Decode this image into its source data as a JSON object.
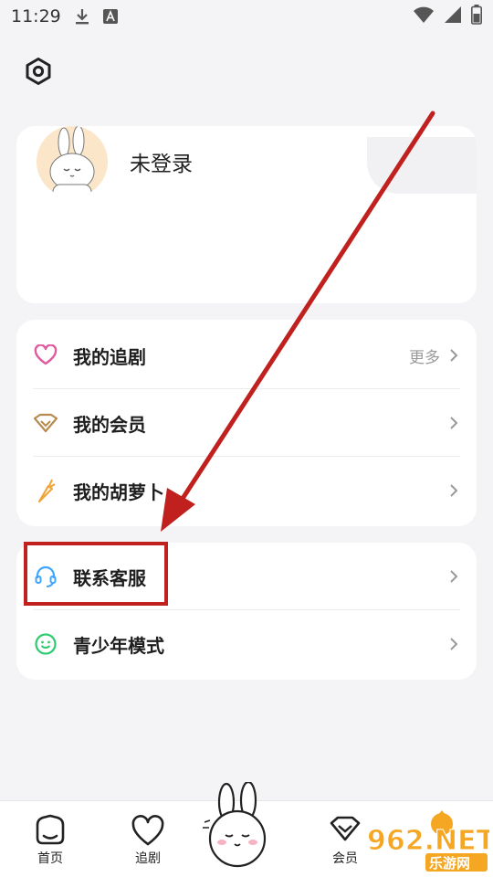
{
  "status_bar": {
    "time": "11:29",
    "icons": [
      "download-icon",
      "a-badge-icon",
      "wifi-icon",
      "signal-icon",
      "battery-icon"
    ]
  },
  "header": {
    "settings_icon": "settings-hexagon-icon"
  },
  "profile": {
    "login_status": "未登录",
    "avatar_icon": "bunny-avatar"
  },
  "menu_group_1": [
    {
      "label": "我的追剧",
      "icon": "heart-icon",
      "more": "更多"
    },
    {
      "label": "我的会员",
      "icon": "vip-diamond-icon"
    },
    {
      "label": "我的胡萝卜",
      "icon": "carrot-icon"
    }
  ],
  "menu_group_2": [
    {
      "label": "联系客服",
      "icon": "headset-icon"
    },
    {
      "label": "青少年模式",
      "icon": "smile-face-icon"
    }
  ],
  "tabbar": {
    "tabs": [
      {
        "label": "首页",
        "icon": "home-icon"
      },
      {
        "label": "追剧",
        "icon": "heart-outline-icon"
      },
      {
        "label": "会员",
        "icon": "vip-icon"
      }
    ]
  },
  "annotation": {
    "color": "#c0201e"
  },
  "watermark": {
    "text_main": "962.NET",
    "text_sub": "乐游网"
  },
  "colors": {
    "background": "#f4f4f6",
    "heart": "#e05aa0",
    "vip": "#b78b4e",
    "carrot": "#f0a53a",
    "headset": "#3fa6ff",
    "smile": "#2ecc71"
  }
}
